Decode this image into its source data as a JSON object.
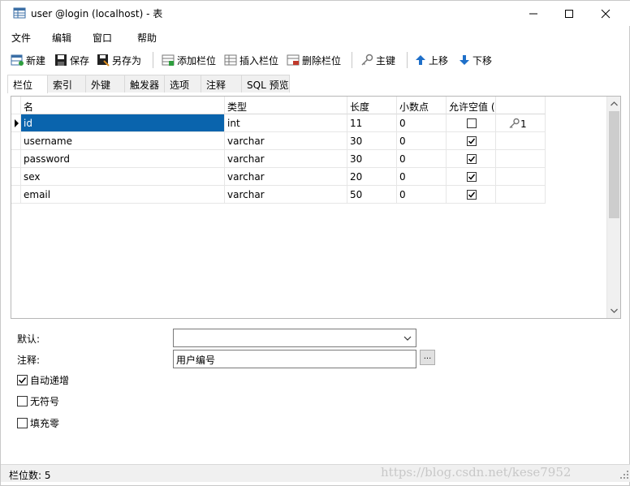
{
  "window": {
    "title": "user @login (localhost) - 表"
  },
  "menu": [
    {
      "label": "文件"
    },
    {
      "label": "编辑"
    },
    {
      "label": "窗口"
    },
    {
      "label": "帮助"
    }
  ],
  "toolbar": {
    "new_label": "新建",
    "save_label": "保存",
    "save_as_label": "另存为",
    "add_field_label": "添加栏位",
    "insert_field_label": "插入栏位",
    "delete_field_label": "删除栏位",
    "primary_key_label": "主键",
    "move_up_label": "上移",
    "move_down_label": "下移"
  },
  "tabs": [
    {
      "label": "栏位",
      "active": true
    },
    {
      "label": "索引"
    },
    {
      "label": "外键"
    },
    {
      "label": "触发器"
    },
    {
      "label": "选项"
    },
    {
      "label": "注释"
    },
    {
      "label": "SQL 预览"
    }
  ],
  "grid": {
    "headers": [
      "名",
      "类型",
      "长度",
      "小数点",
      "允许空值 ("
    ],
    "rows": [
      {
        "name": "id",
        "type": "int",
        "length": "11",
        "decimals": "0",
        "nullable": false,
        "key": "1",
        "selected": true
      },
      {
        "name": "username",
        "type": "varchar",
        "length": "30",
        "decimals": "0",
        "nullable": true,
        "key": ""
      },
      {
        "name": "password",
        "type": "varchar",
        "length": "30",
        "decimals": "0",
        "nullable": true,
        "key": ""
      },
      {
        "name": "sex",
        "type": "varchar",
        "length": "20",
        "decimals": "0",
        "nullable": true,
        "key": ""
      },
      {
        "name": "email",
        "type": "varchar",
        "length": "50",
        "decimals": "0",
        "nullable": true,
        "key": ""
      }
    ]
  },
  "properties": {
    "default_label": "默认:",
    "default_value": "",
    "comment_label": "注释:",
    "comment_value": "用户编号",
    "ellipsis_label": "...",
    "auto_increment_label": "自动递增",
    "auto_increment": true,
    "unsigned_label": "无符号",
    "unsigned": false,
    "zerofill_label": "填充零",
    "zerofill": false
  },
  "status": {
    "text": "栏位数: 5",
    "watermark": "https://blog.csdn.net/kese7952"
  },
  "colors": {
    "selection": "#0a64ad",
    "accent_blue": "#1e6fc9"
  }
}
